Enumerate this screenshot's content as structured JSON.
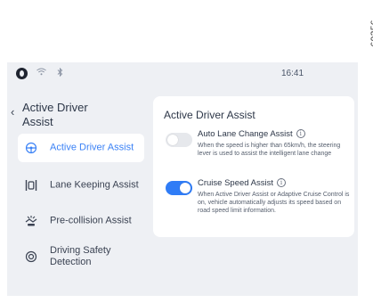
{
  "ref_number": "69256",
  "status_bar": {
    "time": "16:41",
    "wifi_icon": "wifi-icon",
    "bluetooth_icon": "bluetooth-icon"
  },
  "header": {
    "back_icon": "chevron-left-icon",
    "title": "Active Driver Assist"
  },
  "sidebar": {
    "items": [
      {
        "label": "Active Driver Assist",
        "icon": "steering-wheel-icon",
        "active": true
      },
      {
        "label": "Lane Keeping Assist",
        "icon": "lane-keeping-icon",
        "active": false
      },
      {
        "label": "Pre-collision Assist",
        "icon": "pre-collision-icon",
        "active": false
      },
      {
        "label": "Driving Safety Detection",
        "icon": "safety-detection-icon",
        "active": false
      }
    ]
  },
  "panel": {
    "title": "Active Driver Assist",
    "settings": [
      {
        "title": "Auto Lane Change Assist",
        "enabled": false,
        "description": "When the speed is higher than 65km/h, the steering lever is used to assist the intelligent lane change"
      },
      {
        "title": "Cruise Speed Assist",
        "enabled": true,
        "description": "When Active Driver Assist or Adaptive Cruise Control is on, vehicle automatically adjusts its speed based on road speed limit information."
      }
    ]
  },
  "colors": {
    "accent": "#2f7cf6",
    "screen_bg": "#eef0f4",
    "card_bg": "#ffffff"
  }
}
